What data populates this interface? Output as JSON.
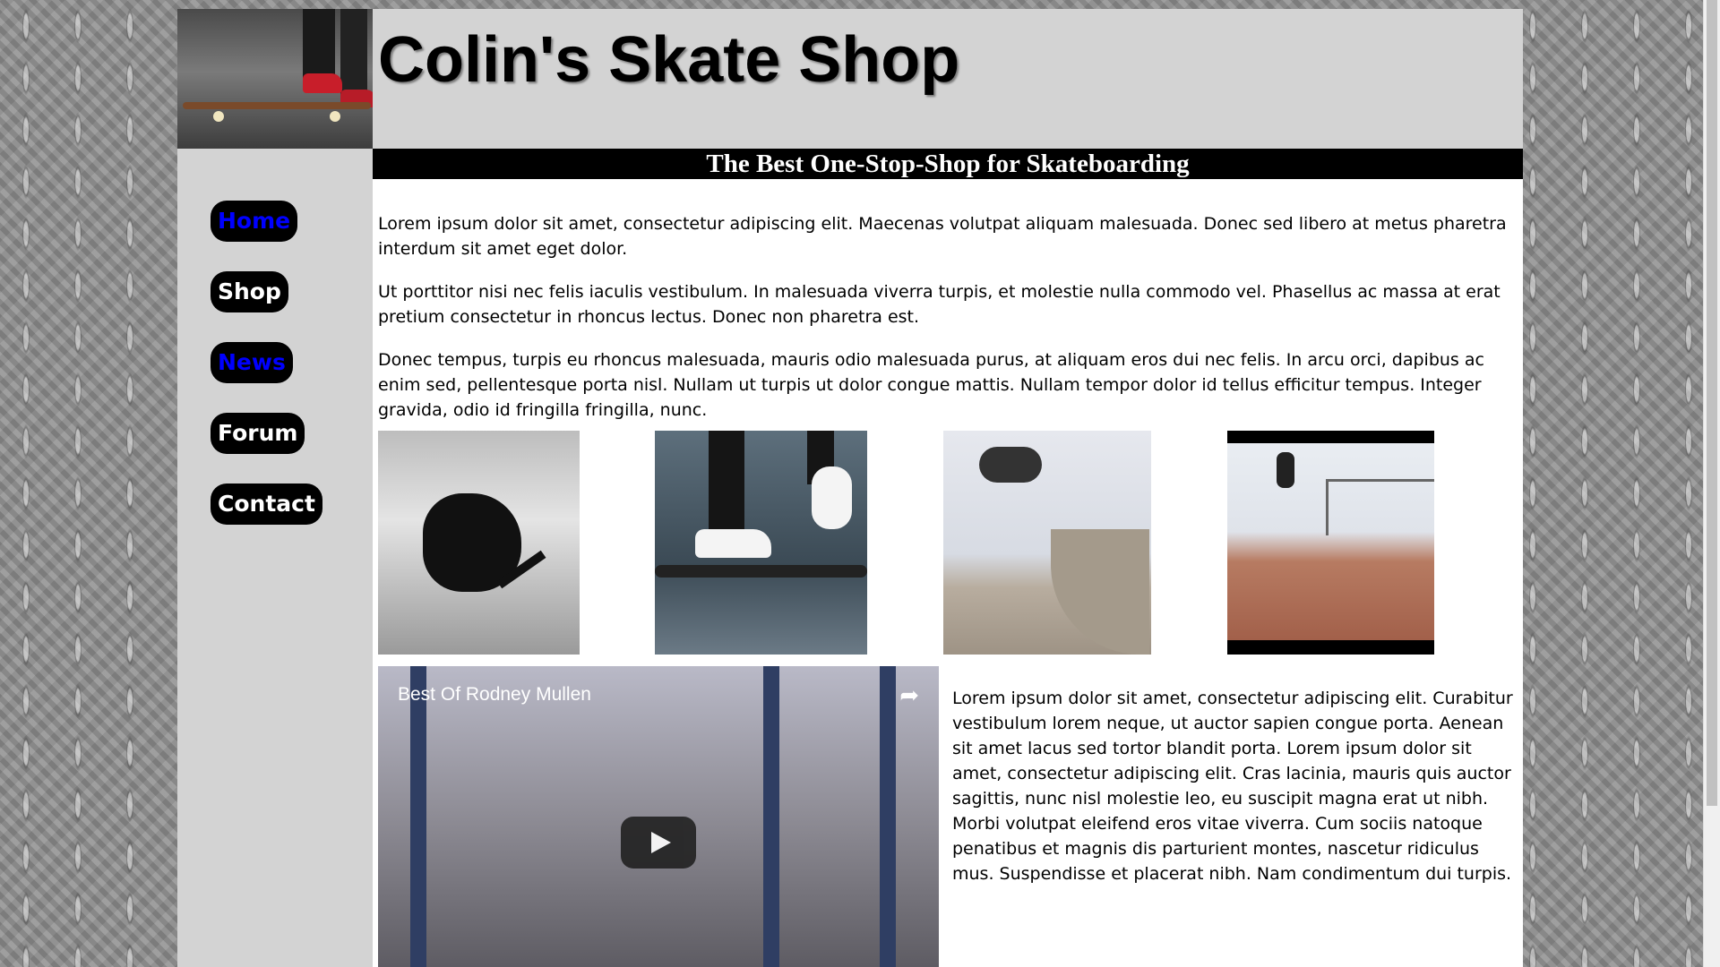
{
  "site": {
    "title": "Colin's Skate Shop",
    "tagline": "The Best One-Stop-Shop for Skateboarding"
  },
  "nav": {
    "items": [
      {
        "label": "Home",
        "active": true
      },
      {
        "label": "Shop",
        "active": false
      },
      {
        "label": "News",
        "active": true
      },
      {
        "label": "Forum",
        "active": false
      },
      {
        "label": "Contact",
        "active": false
      }
    ]
  },
  "main": {
    "paragraphs": [
      "Lorem ipsum dolor sit amet, consectetur adipiscing elit. Maecenas volutpat aliquam malesuada. Donec sed libero at metus pharetra interdum sit amet eget dolor.",
      "Ut porttitor nisi nec felis iaculis vestibulum. In malesuada viverra turpis, et molestie nulla commodo vel. Phasellus ac massa at erat pretium consectetur in rhoncus lectus. Donec non pharetra est.",
      "Donec tempus, turpis eu rhoncus malesuada, mauris odio malesuada purus, at aliquam eros dui nec felis. In arcu orci, dapibus ac enim sed, pellentesque porta nisl. Nullam ut turpis ut dolor congue mattis. Nullam tempor dolor id tellus efficitur tempus. Integer gravida, odio id fringilla fringilla, nunc."
    ],
    "side_paragraph": "Lorem ipsum dolor sit amet, consectetur adipiscing elit. Curabitur vestibulum lorem neque, ut auctor sapien congue porta. Aenean sit amet lacus sed tortor blandit porta. Lorem ipsum dolor sit amet, consectetur adipiscing elit. Cras lacinia, mauris quis auctor sagittis, nunc nisl molestie leo, eu suscipit magna erat ut nibh. Morbi volutpat eleifend eros vitae viverra. Cum sociis natoque penatibus et magnis dis parturient montes, nascetur ridiculus mus. Suspendisse et placerat nibh. Nam condimentum dui turpis."
  },
  "video": {
    "title": "Best Of Rodney Mullen",
    "share_icon": "share-icon",
    "play_icon": "play-icon"
  },
  "colors": {
    "page_bg": "#d3d3d3",
    "nav_bg": "#000000",
    "nav_active": "#0000ff",
    "tagline_bg": "#000000"
  }
}
